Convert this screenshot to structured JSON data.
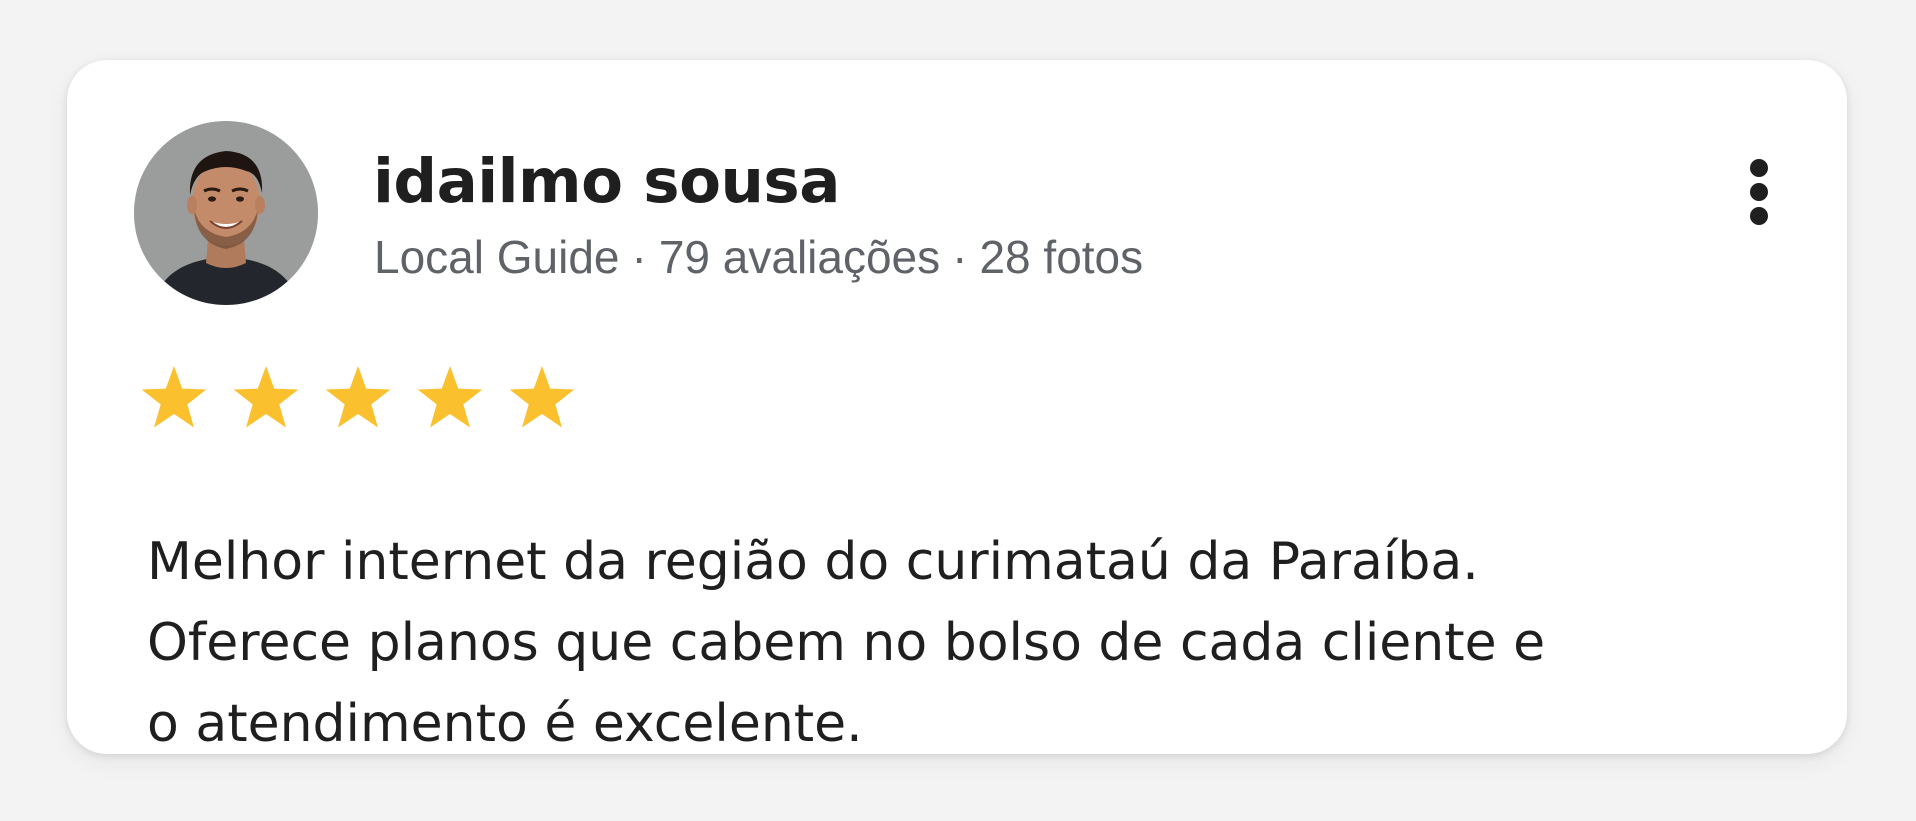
{
  "review": {
    "author_name": "idailmo sousa",
    "author_meta": {
      "badge": "Local Guide",
      "reviews": "79 avaliações",
      "photos": "28 fotos",
      "separator": "·"
    },
    "rating": 5,
    "rating_max": 5,
    "text_lines": [
      "Melhor internet da região do curimataú da Paraíba.",
      "Oferece planos que cabem no bolso de cada cliente e",
      "o atendimento é excelente."
    ]
  },
  "icons": {
    "menu": "more-vert-icon",
    "star": "star-icon",
    "avatar": "avatar-photo"
  },
  "colors": {
    "background": "#f3f3f3",
    "card": "#ffffff",
    "star": "#fbc02d",
    "name": "#1f1f1f",
    "meta": "#5f6368",
    "body_text": "#1f1f1f"
  }
}
